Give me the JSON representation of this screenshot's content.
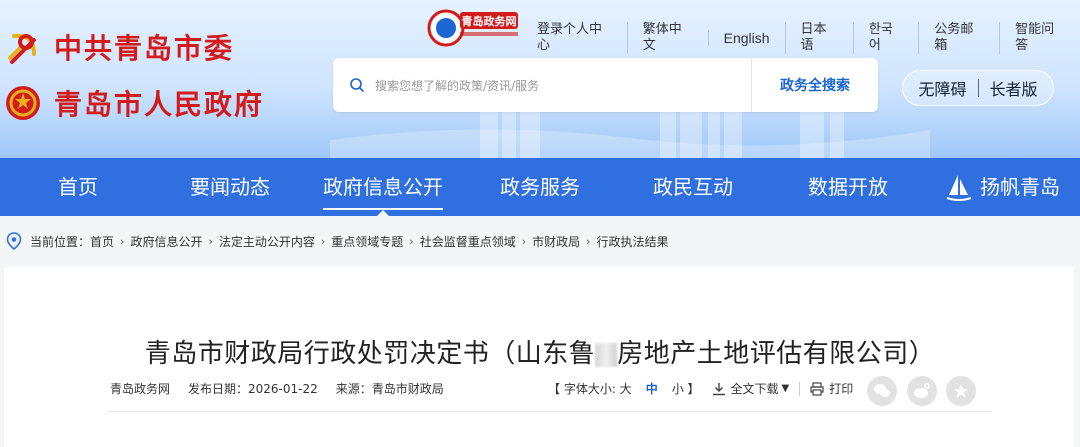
{
  "brand": {
    "line1": "中共青岛市委",
    "line2": "青岛市人民政府",
    "logo_text": "青岛政务网"
  },
  "top_links": [
    "登录个人中心",
    "繁体中文",
    "English",
    "日本语",
    "한국어",
    "公务邮箱",
    "智能问答"
  ],
  "search": {
    "placeholder": "搜索您想了解的政策/资讯/服务",
    "button": "政务全搜索"
  },
  "accessibility": {
    "barrier_free": "无障碍",
    "elder": "长者版"
  },
  "nav": {
    "items": [
      "首页",
      "要闻动态",
      "政府信息公开",
      "政务服务",
      "政民互动",
      "数据开放",
      "扬帆青岛"
    ],
    "active": "政府信息公开"
  },
  "breadcrumb": {
    "label": "当前位置：",
    "items": [
      "首页",
      "政府信息公开",
      "法定主动公开内容",
      "重点领域专题",
      "社会监督重点领域",
      "市财政局",
      "行政执法结果"
    ]
  },
  "article": {
    "title_part1": "青岛市财政局行政处罚决定书（山东鲁",
    "title_part2": "房地产土地评估有限公司）",
    "source_site": "青岛政务网",
    "publish_date": "发布日期：2026-01-22",
    "source": "来源：青岛市财政局"
  },
  "tools": {
    "font_size_label": "【 字体大小: 大",
    "font_mid": "中",
    "font_small": "小 】",
    "download": "全文下载",
    "print": "打印"
  },
  "colors": {
    "nav_bg": "#2f6fe0",
    "brand_red": "#d31b1b",
    "accent_blue": "#1c66d4"
  }
}
